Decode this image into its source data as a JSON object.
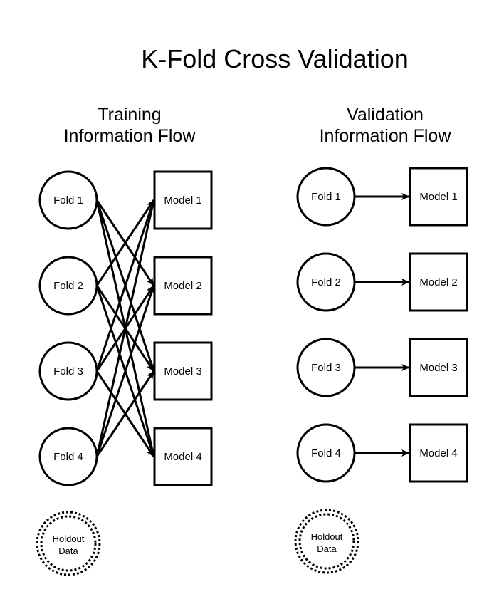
{
  "title": "K-Fold Cross Validation",
  "panels": {
    "training": {
      "heading_line1": "Training",
      "heading_line2": "Information Flow",
      "folds": [
        "Fold 1",
        "Fold 2",
        "Fold 3",
        "Fold 4"
      ],
      "models": [
        "Model 1",
        "Model 2",
        "Model 3",
        "Model 4"
      ],
      "edges": [
        [
          0,
          1
        ],
        [
          0,
          2
        ],
        [
          0,
          3
        ],
        [
          1,
          0
        ],
        [
          1,
          2
        ],
        [
          1,
          3
        ],
        [
          2,
          0
        ],
        [
          2,
          1
        ],
        [
          2,
          3
        ],
        [
          3,
          0
        ],
        [
          3,
          1
        ],
        [
          3,
          2
        ]
      ],
      "holdout_line1": "Holdout",
      "holdout_line2": "Data"
    },
    "validation": {
      "heading_line1": "Validation",
      "heading_line2": "Information Flow",
      "folds": [
        "Fold 1",
        "Fold 2",
        "Fold 3",
        "Fold 4"
      ],
      "models": [
        "Model 1",
        "Model 2",
        "Model 3",
        "Model 4"
      ],
      "edges": [
        [
          0,
          0
        ],
        [
          1,
          1
        ],
        [
          2,
          2
        ],
        [
          3,
          3
        ]
      ],
      "holdout_line1": "Holdout",
      "holdout_line2": "Data"
    }
  },
  "colors": {
    "stroke": "#000000",
    "background": "#ffffff"
  }
}
